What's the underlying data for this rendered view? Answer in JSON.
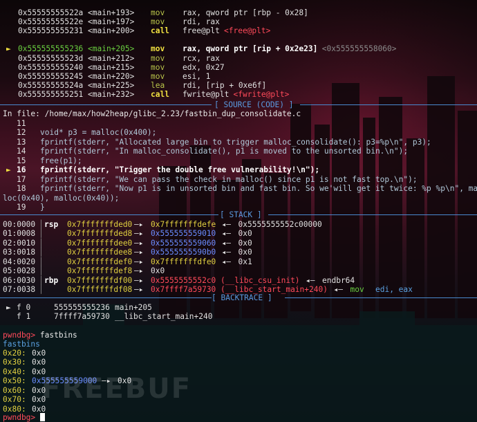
{
  "disasm": [
    {
      "arrow": "",
      "addr": "0x55555555522a",
      "sym": "<main+193>",
      "mn": "mov",
      "ops": "rax, qword ptr [rbp - 0x28]",
      "extra": ""
    },
    {
      "arrow": "",
      "addr": "0x55555555522e",
      "sym": "<main+197>",
      "mn": "mov",
      "ops": "rdi, rax",
      "extra": ""
    },
    {
      "arrow": "",
      "addr": "0x555555555231",
      "sym": "<main+200>",
      "mn": "call",
      "ops": "free@plt",
      "extra": "<free@plt>"
    },
    {
      "arrow": "►",
      "addr": "0x555555555236",
      "sym": "<main+205>",
      "mn": "mov",
      "ops": "rax, qword ptr [rip + 0x2e23]",
      "extra": "<0x555555558060>"
    },
    {
      "arrow": "",
      "addr": "0x55555555523d",
      "sym": "<main+212>",
      "mn": "mov",
      "ops": "rcx, rax",
      "extra": ""
    },
    {
      "arrow": "",
      "addr": "0x555555555240",
      "sym": "<main+215>",
      "mn": "mov",
      "ops": "edx, 0x27",
      "extra": ""
    },
    {
      "arrow": "",
      "addr": "0x555555555245",
      "sym": "<main+220>",
      "mn": "mov",
      "ops": "esi, 1",
      "extra": ""
    },
    {
      "arrow": "",
      "addr": "0x55555555524a",
      "sym": "<main+225>",
      "mn": "lea",
      "ops": "rdi, [rip + 0xe6f]",
      "extra": ""
    },
    {
      "arrow": "",
      "addr": "0x555555555251",
      "sym": "<main+232>",
      "mn": "call",
      "ops": "fwrite@plt",
      "extra": "<fwrite@plt>"
    }
  ],
  "source_header": "[ SOURCE (CODE) ]",
  "source_file": "In file: /home/max/how2heap/glibc_2.23/fastbin_dup_consolidate.c",
  "source_lines": [
    {
      "n": "11",
      "code": "",
      "cur": false
    },
    {
      "n": "12",
      "code": "void* p3 = malloc(0x400);",
      "cur": false
    },
    {
      "n": "13",
      "code": "fprintf(stderr, \"Allocated large bin to trigger malloc_consolidate(): p3=%p\\n\", p3);",
      "cur": false
    },
    {
      "n": "14",
      "code": "fprintf(stderr, \"In malloc_consolidate(), p1 is moved to the unsorted bin.\\n\");",
      "cur": false
    },
    {
      "n": "15",
      "code": "free(p1);",
      "cur": false
    },
    {
      "n": "16",
      "code": "fprintf(stderr, \"Trigger the double free vulnerability!\\n\");",
      "cur": true
    },
    {
      "n": "17",
      "code": "fprintf(stderr, \"We can pass the check in malloc() since p1 is not fast top.\\n\");",
      "cur": false
    },
    {
      "n": "18",
      "code": "fprintf(stderr, \"Now p1 is in unsorted bin and fast bin. So we'will get it twice: %p %p\\n\", mal",
      "cur": false
    },
    {
      "n": "",
      "code": "loc(0x40), malloc(0x40));",
      "cur": false
    },
    {
      "n": "19",
      "code": "}",
      "cur": false
    }
  ],
  "stack_header": "[ STACK ]",
  "stack": [
    {
      "idx": "00:0000",
      "reg": "rsp",
      "addr": "0x7fffffffded0",
      "v1": "0x7fffffffdefe",
      "v1c": "yel",
      "v2": "0x5555555552c00000",
      "v2c": "white",
      "v3": "",
      "v3c": ""
    },
    {
      "idx": "01:0008",
      "reg": "",
      "addr": "0x7fffffffded8",
      "v1": "0x555555559010",
      "v1c": "blue",
      "v2": "0x0",
      "v2c": "white",
      "v3": "",
      "v3c": ""
    },
    {
      "idx": "02:0010",
      "reg": "",
      "addr": "0x7fffffffdee0",
      "v1": "0x555555559060",
      "v1c": "blue",
      "v2": "0x0",
      "v2c": "white",
      "v3": "",
      "v3c": ""
    },
    {
      "idx": "03:0018",
      "reg": "",
      "addr": "0x7fffffffdee8",
      "v1": "0x5555555590b0",
      "v1c": "blue",
      "v2": "0x0",
      "v2c": "white",
      "v3": "",
      "v3c": ""
    },
    {
      "idx": "04:0020",
      "reg": "",
      "addr": "0x7fffffffdef0",
      "v1": "0x7fffffffdfe0",
      "v1c": "yel",
      "v2": "0x1",
      "v2c": "white",
      "v3": "",
      "v3c": ""
    },
    {
      "idx": "05:0028",
      "reg": "",
      "addr": "0x7fffffffdef8",
      "v1": "0x0",
      "v1c": "white",
      "v2": "",
      "v2c": "",
      "v3": "",
      "v3c": ""
    },
    {
      "idx": "06:0030",
      "reg": "rbp",
      "addr": "0x7fffffffdf00",
      "v1": "0x5555555552c0 (__libc_csu_init)",
      "v1c": "red",
      "v2": "endbr64",
      "v2c": "white",
      "v3": "",
      "v3c": ""
    },
    {
      "idx": "07:0038",
      "reg": "",
      "addr": "0x7fffffffdf08",
      "v1": "0x7ffff7a59730 (__libc_start_main+240)",
      "v1c": "red",
      "v2": "mov",
      "v2c": "green",
      "v3": "edi, eax",
      "v3c": "cyan"
    }
  ],
  "backtrace_header": "[ BACKTRACE ]",
  "backtrace": [
    {
      "cur": true,
      "frame": "f 0",
      "addr": "555555555236",
      "sym": "main+205"
    },
    {
      "cur": false,
      "frame": "f 1",
      "addr": "7ffff7a59730",
      "sym": "__libc_start_main+240"
    }
  ],
  "prompt": "pwndbg>",
  "command": "fastbins",
  "fastbins_title": "fastbins",
  "fastbins": [
    {
      "size": "0x20:",
      "val": "0x0",
      "link": ""
    },
    {
      "size": "0x30:",
      "val": "0x0",
      "link": ""
    },
    {
      "size": "0x40:",
      "val": "0x0",
      "link": ""
    },
    {
      "size": "0x50:",
      "val": "0x555555559000",
      "link": "0x0"
    },
    {
      "size": "0x60:",
      "val": "0x0",
      "link": ""
    },
    {
      "size": "0x70:",
      "val": "0x0",
      "link": ""
    },
    {
      "size": "0x80:",
      "val": "0x0",
      "link": ""
    }
  ],
  "watermark": "FREEBUF",
  "colors": {
    "accent": "#4a8ad0",
    "prompt": "#ff4a5a",
    "mnemonic": "#b8c44a",
    "call": "#f0e040"
  }
}
